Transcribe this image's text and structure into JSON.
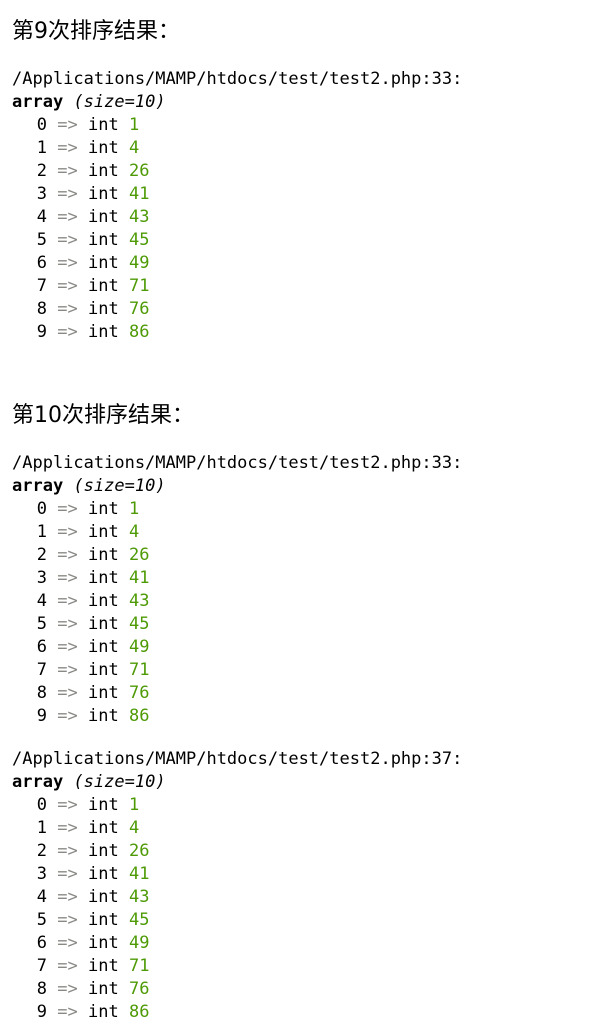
{
  "colors": {
    "value": "#4e9a06",
    "arrow": "#888a85",
    "text": "#000000"
  },
  "sections": [
    {
      "heading": "第9次排序结果：",
      "dumps": [
        {
          "path": "/Applications/MAMP/htdocs/test/test2.php:33:",
          "keyword": "array",
          "size": "(size=10)",
          "items": [
            {
              "index": "0",
              "arrow": "=>",
              "type": "int",
              "value": "1"
            },
            {
              "index": "1",
              "arrow": "=>",
              "type": "int",
              "value": "4"
            },
            {
              "index": "2",
              "arrow": "=>",
              "type": "int",
              "value": "26"
            },
            {
              "index": "3",
              "arrow": "=>",
              "type": "int",
              "value": "41"
            },
            {
              "index": "4",
              "arrow": "=>",
              "type": "int",
              "value": "43"
            },
            {
              "index": "5",
              "arrow": "=>",
              "type": "int",
              "value": "45"
            },
            {
              "index": "6",
              "arrow": "=>",
              "type": "int",
              "value": "49"
            },
            {
              "index": "7",
              "arrow": "=>",
              "type": "int",
              "value": "71"
            },
            {
              "index": "8",
              "arrow": "=>",
              "type": "int",
              "value": "76"
            },
            {
              "index": "9",
              "arrow": "=>",
              "type": "int",
              "value": "86"
            }
          ]
        }
      ]
    },
    {
      "heading": "第10次排序结果：",
      "dumps": [
        {
          "path": "/Applications/MAMP/htdocs/test/test2.php:33:",
          "keyword": "array",
          "size": "(size=10)",
          "items": [
            {
              "index": "0",
              "arrow": "=>",
              "type": "int",
              "value": "1"
            },
            {
              "index": "1",
              "arrow": "=>",
              "type": "int",
              "value": "4"
            },
            {
              "index": "2",
              "arrow": "=>",
              "type": "int",
              "value": "26"
            },
            {
              "index": "3",
              "arrow": "=>",
              "type": "int",
              "value": "41"
            },
            {
              "index": "4",
              "arrow": "=>",
              "type": "int",
              "value": "43"
            },
            {
              "index": "5",
              "arrow": "=>",
              "type": "int",
              "value": "45"
            },
            {
              "index": "6",
              "arrow": "=>",
              "type": "int",
              "value": "49"
            },
            {
              "index": "7",
              "arrow": "=>",
              "type": "int",
              "value": "71"
            },
            {
              "index": "8",
              "arrow": "=>",
              "type": "int",
              "value": "76"
            },
            {
              "index": "9",
              "arrow": "=>",
              "type": "int",
              "value": "86"
            }
          ]
        },
        {
          "path": "/Applications/MAMP/htdocs/test/test2.php:37:",
          "keyword": "array",
          "size": "(size=10)",
          "items": [
            {
              "index": "0",
              "arrow": "=>",
              "type": "int",
              "value": "1"
            },
            {
              "index": "1",
              "arrow": "=>",
              "type": "int",
              "value": "4"
            },
            {
              "index": "2",
              "arrow": "=>",
              "type": "int",
              "value": "26"
            },
            {
              "index": "3",
              "arrow": "=>",
              "type": "int",
              "value": "41"
            },
            {
              "index": "4",
              "arrow": "=>",
              "type": "int",
              "value": "43"
            },
            {
              "index": "5",
              "arrow": "=>",
              "type": "int",
              "value": "45"
            },
            {
              "index": "6",
              "arrow": "=>",
              "type": "int",
              "value": "49"
            },
            {
              "index": "7",
              "arrow": "=>",
              "type": "int",
              "value": "71"
            },
            {
              "index": "8",
              "arrow": "=>",
              "type": "int",
              "value": "76"
            },
            {
              "index": "9",
              "arrow": "=>",
              "type": "int",
              "value": "86"
            }
          ]
        }
      ]
    }
  ]
}
